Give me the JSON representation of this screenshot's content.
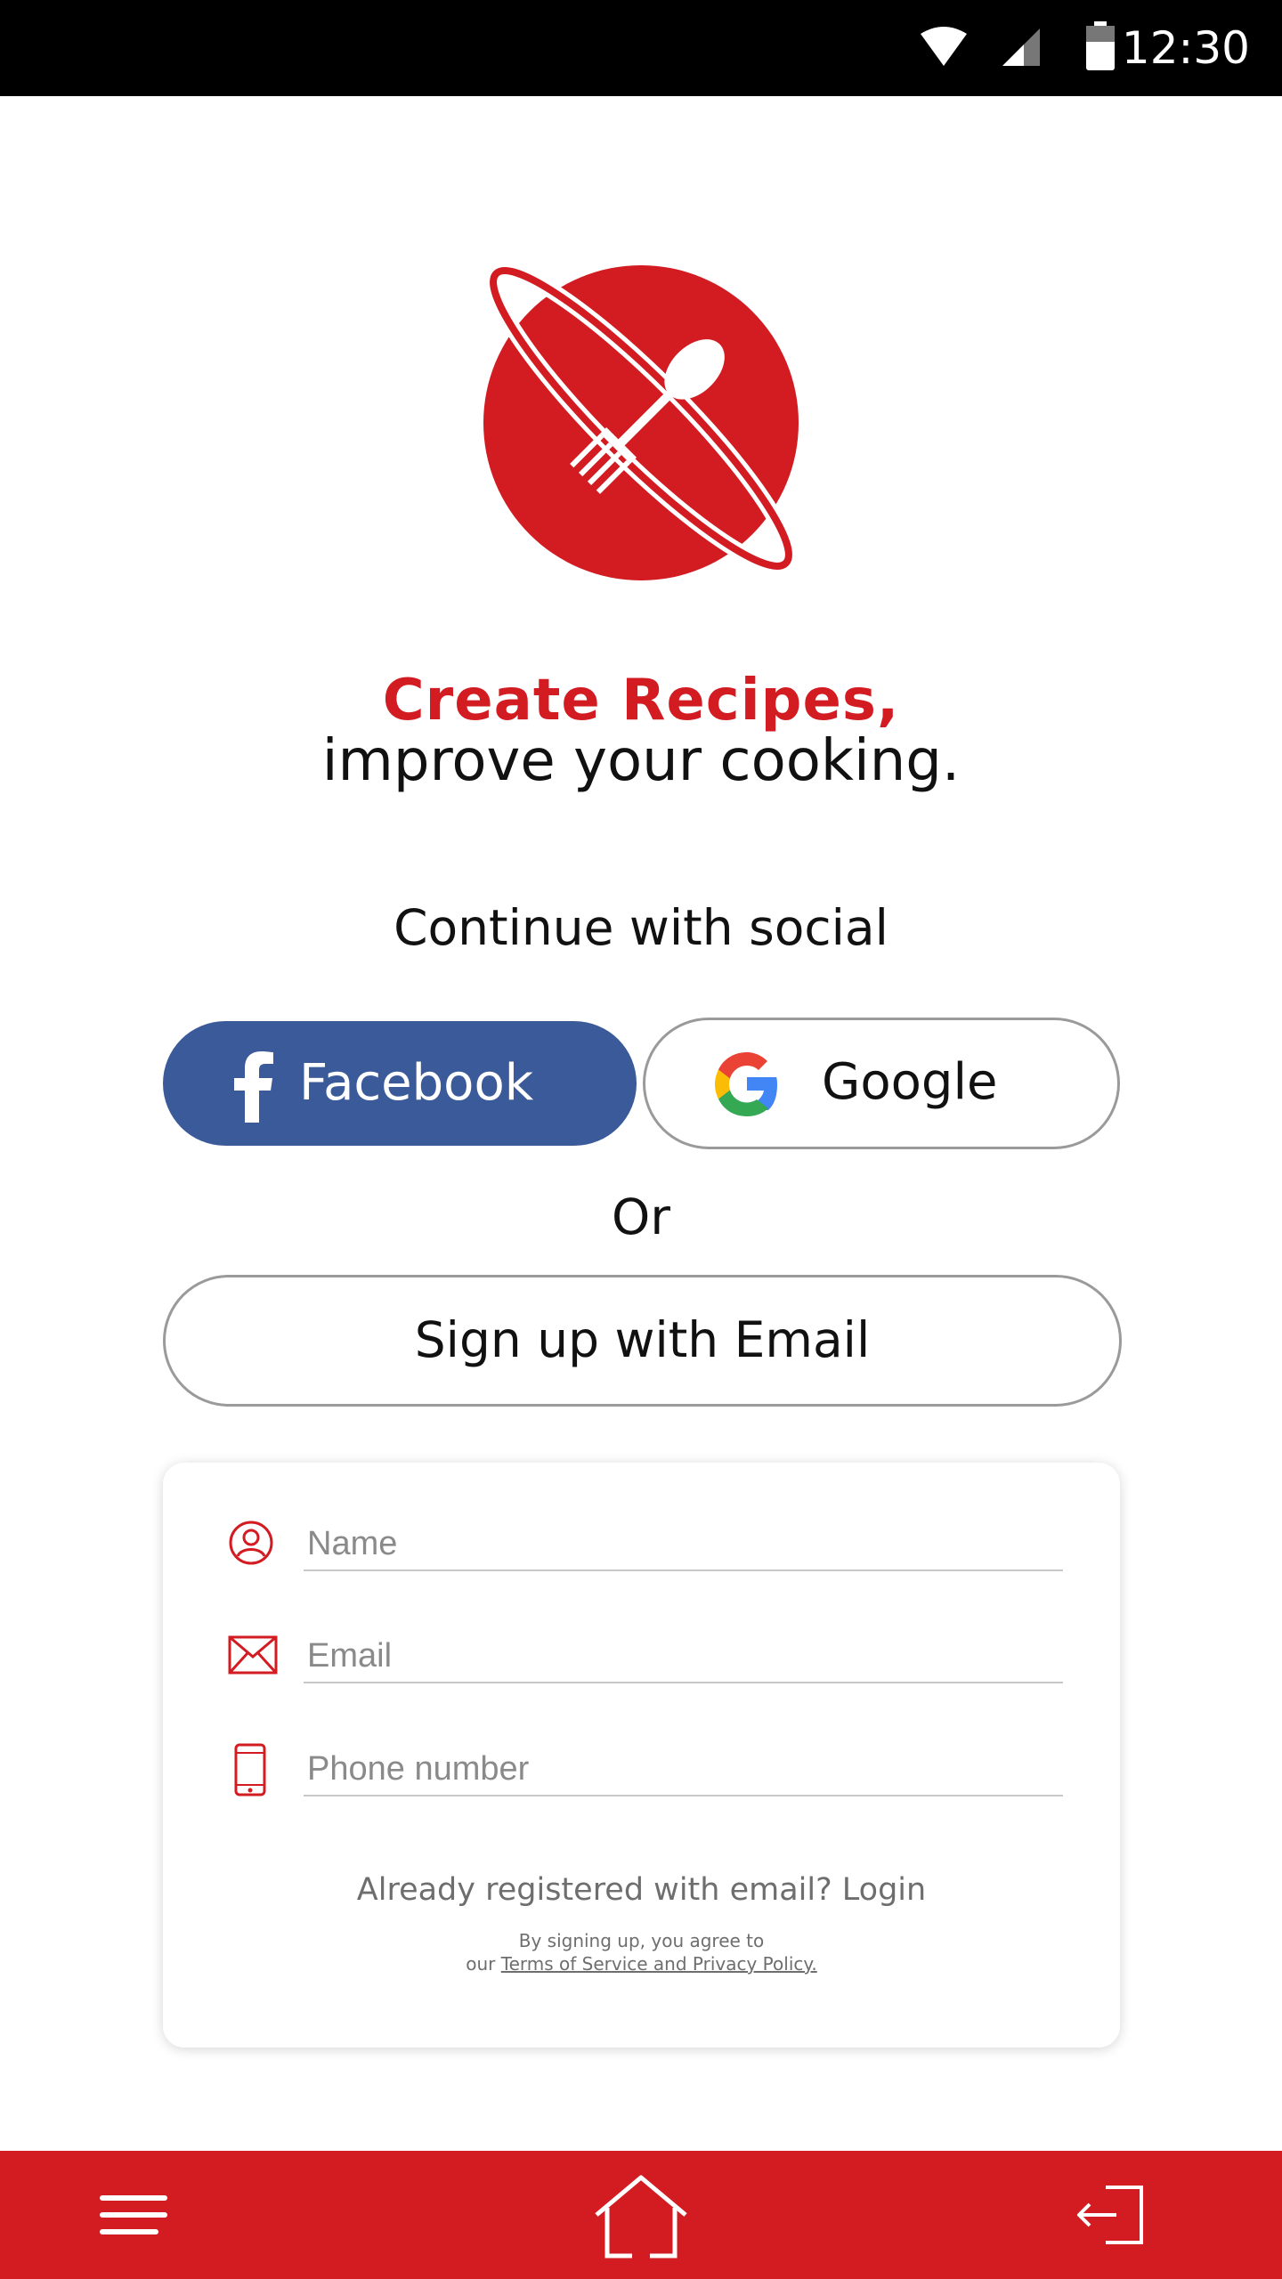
{
  "status_bar": {
    "time": "12:30"
  },
  "branding": {
    "headline_1": "Create Recipes,",
    "headline_2": "improve your cooking.",
    "accent_color": "#d31b22"
  },
  "social": {
    "title": "Continue with social",
    "facebook_label": "Facebook",
    "google_label": "Google",
    "facebook_color": "#3b5a9a"
  },
  "divider_text": "Or",
  "email_signup": {
    "label": "Sign up with Email"
  },
  "form": {
    "name_placeholder": "Name",
    "email_placeholder": "Email",
    "phone_placeholder": "Phone number",
    "login_text": "Already registered with email? Login",
    "terms_prefix_1": "By signing up, you agree to",
    "terms_prefix_2": "our ",
    "terms_link": "Terms of Service and Privacy Policy."
  },
  "icons": {
    "status": [
      "wifi-icon",
      "signal-icon",
      "battery-icon"
    ],
    "nav": [
      "menu-icon",
      "home-icon",
      "logout-icon"
    ]
  }
}
